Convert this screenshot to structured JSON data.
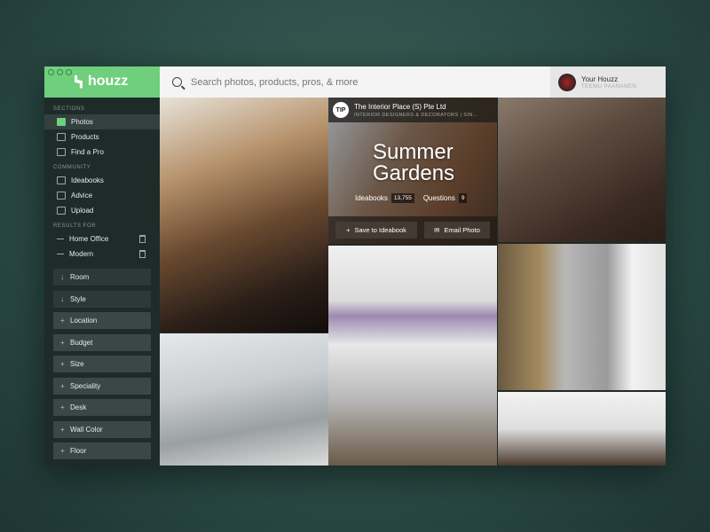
{
  "app": {
    "brand": "houzz"
  },
  "search": {
    "placeholder": "Search photos, products, pros, & more"
  },
  "user": {
    "title": "Your Houzz",
    "name": "TEEMU PAANANEN"
  },
  "sidebar": {
    "sections_label": "SECTIONS",
    "sections": [
      {
        "label": "Photos",
        "icon": "photos-icon",
        "active": true
      },
      {
        "label": "Products",
        "icon": "products-icon"
      },
      {
        "label": "Find a Pro",
        "icon": "find-pro-icon"
      }
    ],
    "community_label": "COMMUNITY",
    "community": [
      {
        "label": "Ideabooks",
        "icon": "ideabooks-icon"
      },
      {
        "label": "Advice",
        "icon": "advice-icon"
      },
      {
        "label": "Upload",
        "icon": "upload-icon"
      }
    ],
    "results_label": "RESULTS FOR",
    "results": [
      {
        "label": "Home Office"
      },
      {
        "label": "Modern"
      }
    ],
    "filters": [
      {
        "label": "Room",
        "sym": "↓"
      },
      {
        "label": "Style",
        "sym": "↓"
      },
      {
        "label": "Location",
        "sym": "+"
      },
      {
        "label": "Budget",
        "sym": "+"
      },
      {
        "label": "Size",
        "sym": "+"
      },
      {
        "label": "Speciality",
        "sym": "+"
      },
      {
        "label": "Desk",
        "sym": "+"
      },
      {
        "label": "Wall Color",
        "sym": "+"
      },
      {
        "label": "Floor",
        "sym": "+"
      }
    ]
  },
  "overlay": {
    "logo": "TIP",
    "company": "The Interior Place (S) Pte Ltd",
    "subtitle": "INTERIOR DESIGNERS & DECORATORS | SIN...",
    "title_1": "Summer",
    "title_2": "Gardens",
    "ideabooks_label": "Ideabooks",
    "ideabooks_count": "13,755",
    "questions_label": "Questions",
    "questions_count": "9",
    "save_label": "Save to Ideabook",
    "email_label": "Email Photo"
  }
}
